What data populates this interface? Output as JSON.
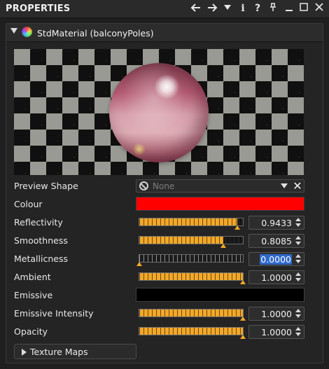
{
  "panel": {
    "title": "PROPERTIES",
    "icons": [
      {
        "name": "back-arrow-icon",
        "glyph": "🡐"
      },
      {
        "name": "forward-arrow-icon",
        "glyph": "🡒"
      },
      {
        "name": "dropdown-triangle-icon",
        "glyph": "▼"
      },
      {
        "name": "info-icon",
        "glyph": "i"
      },
      {
        "name": "help-icon",
        "glyph": "?"
      },
      {
        "name": "pin-icon",
        "glyph": "⌖"
      },
      {
        "name": "minimize-icon",
        "glyph": "—"
      },
      {
        "name": "maximize-icon",
        "glyph": "☐"
      },
      {
        "name": "close-icon",
        "glyph": "✕"
      }
    ]
  },
  "material": {
    "header": "StdMaterial (balconyPoles)",
    "icon": "material-sphere-icon"
  },
  "properties": {
    "preview_shape": {
      "label": "Preview Shape",
      "value": "None",
      "icon": "none-icon"
    },
    "colour": {
      "label": "Colour",
      "color": "#ff0000"
    },
    "reflectivity": {
      "label": "Reflectivity",
      "value": "0.9433",
      "level": 0.9433
    },
    "smoothness": {
      "label": "Smoothness",
      "value": "0.8085",
      "level": 0.8085
    },
    "metallicness": {
      "label": "Metallicness",
      "value": "0.0000",
      "level": 0.0
    },
    "ambient": {
      "label": "Ambient",
      "value": "1.0000",
      "level": 1.0
    },
    "emissive": {
      "label": "Emissive",
      "color": "#000000"
    },
    "emissive_intensity": {
      "label": "Emissive Intensity",
      "value": "1.0000",
      "level": 1.0
    },
    "opacity": {
      "label": "Opacity",
      "value": "1.0000",
      "level": 1.0
    }
  },
  "texture_maps": {
    "label": "Texture Maps"
  },
  "colors": {
    "accent": "#f2a82a",
    "selection": "#2f68c8",
    "background": "#1f1f1f"
  }
}
